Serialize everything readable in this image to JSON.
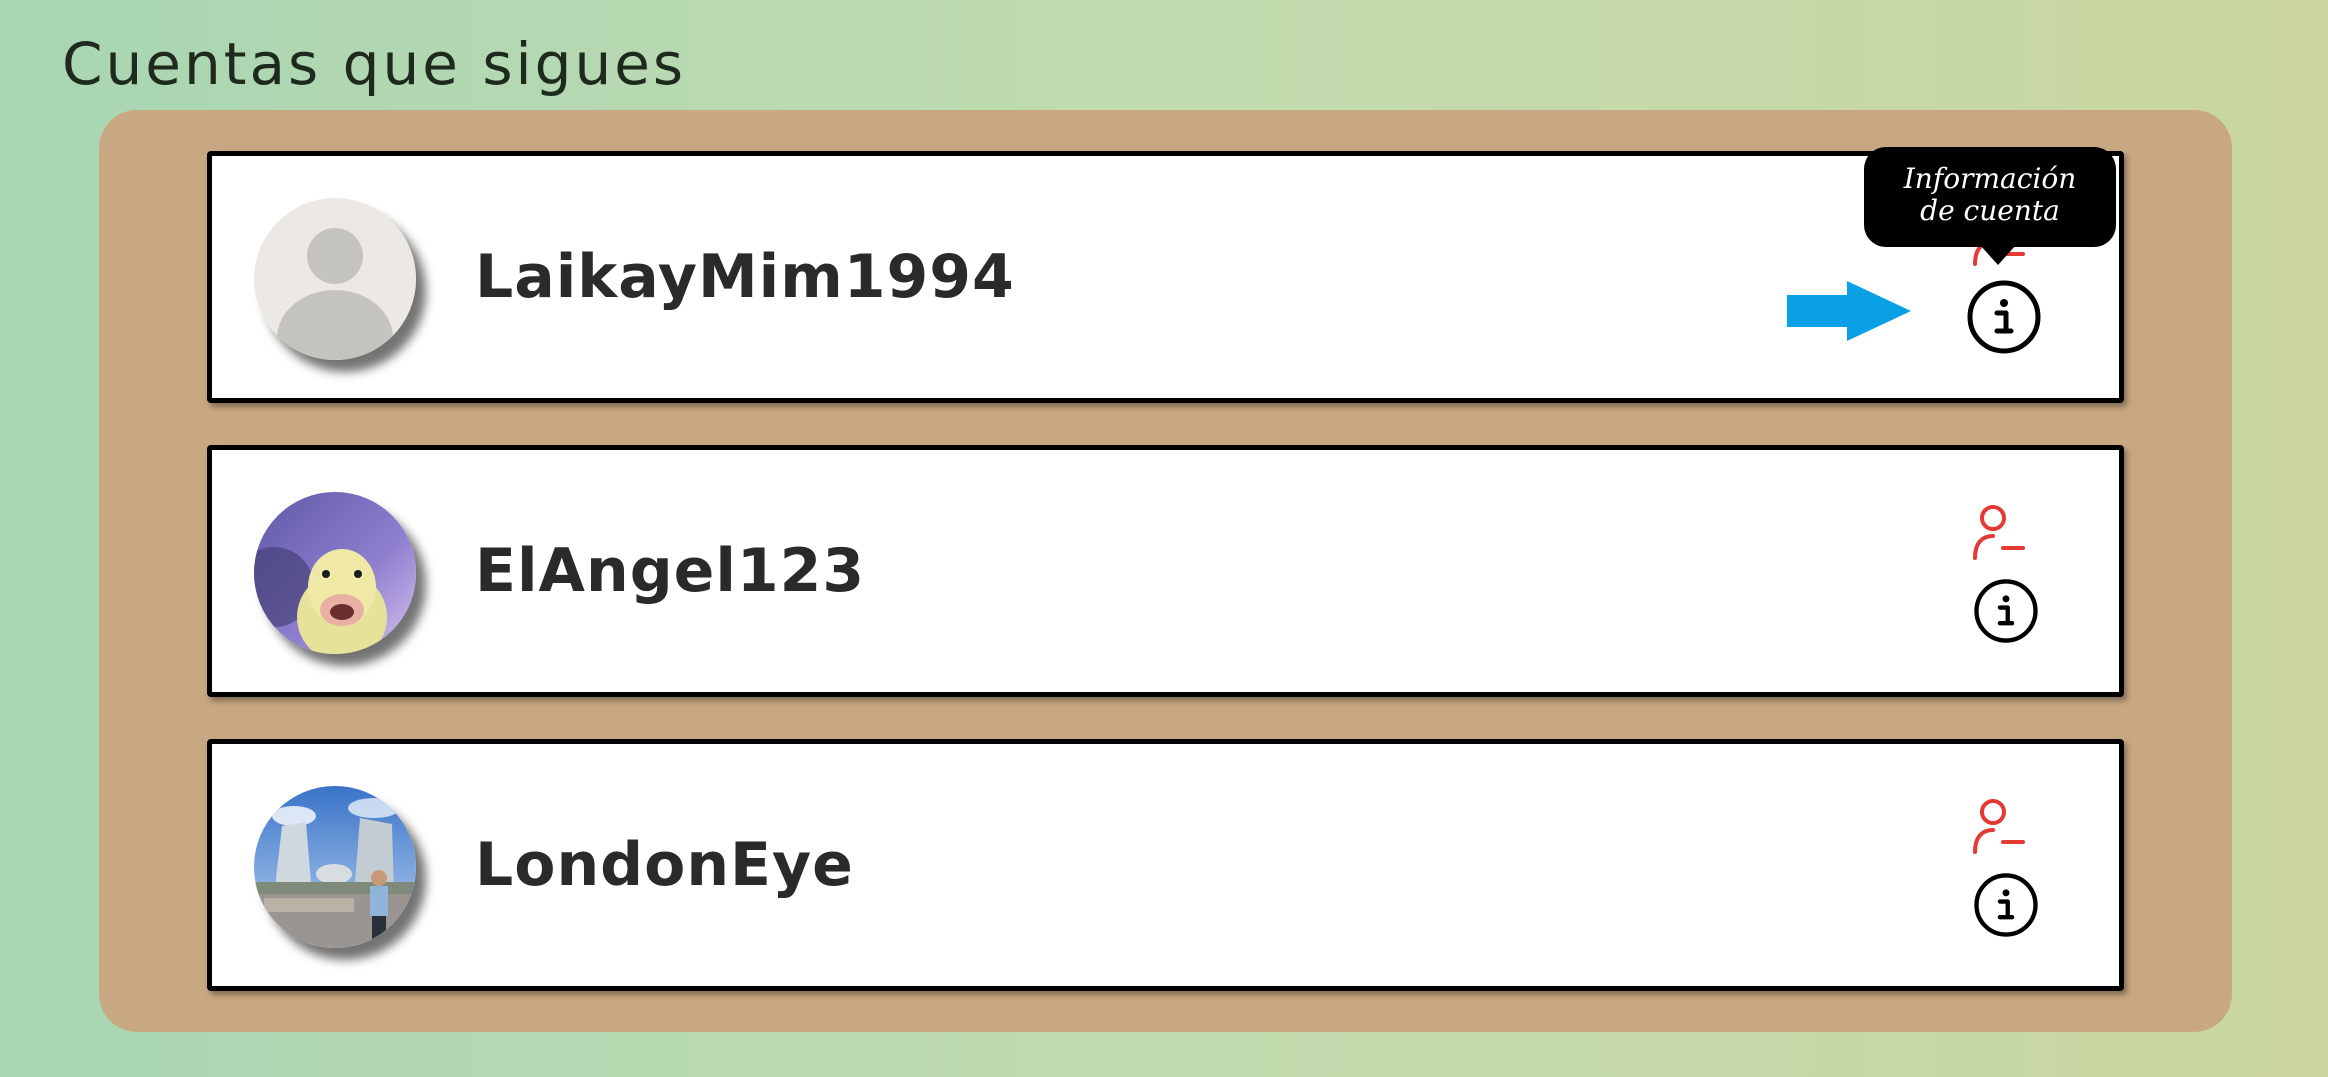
{
  "page": {
    "title": "Cuentas que sigues"
  },
  "accounts": [
    {
      "username": "LaikayMim1994",
      "avatar": "default-avatar"
    },
    {
      "username": "ElAngel123",
      "avatar": "duck-avatar"
    },
    {
      "username": "LondonEye",
      "avatar": "city-avatar"
    }
  ],
  "tooltip": {
    "line1": "Información",
    "line2": "de cuenta"
  },
  "icons": {
    "unfollow": "user-minus-icon",
    "info": "info-icon",
    "pointer": "arrow-right-icon"
  },
  "colors": {
    "background_start": "#a8d5b3",
    "background_end": "#cbd6a0",
    "panel": "#c8a882",
    "unfollow_red": "#e53935",
    "arrow_blue": "#0aa0e6"
  }
}
